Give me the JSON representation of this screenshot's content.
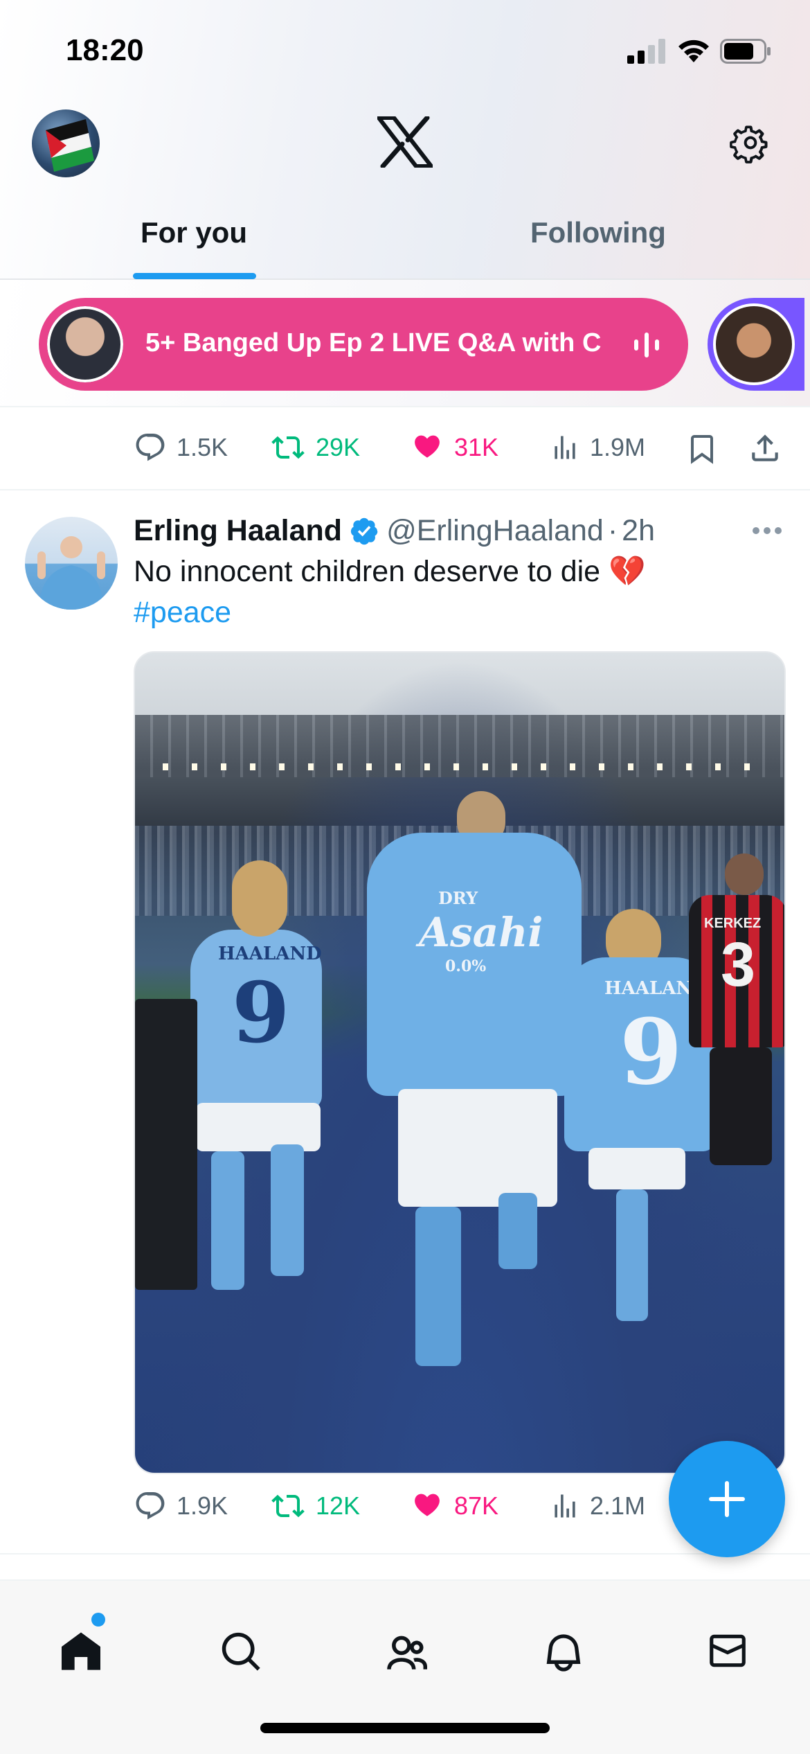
{
  "status_bar": {
    "time": "18:20"
  },
  "header": {
    "tabs": [
      {
        "label": "For you",
        "active": true
      },
      {
        "label": "Following",
        "active": false
      }
    ]
  },
  "spaces": {
    "pill_text": "5+ Banged Up Ep 2 LIVE Q&A with C",
    "pill_color": "#e8428b",
    "next_color": "#7856ff"
  },
  "previous_post_actions": {
    "replies": "1.5K",
    "reposts": "29K",
    "likes": "31K",
    "views": "1.9M"
  },
  "post": {
    "name": "Erling Haaland",
    "handle": "@ErlingHaaland",
    "separator": "·",
    "time": "2h",
    "text": "No innocent children deserve to die 💔",
    "hashtag": "#peace",
    "media_jersey_text": [
      "HAALAND",
      "9",
      "DRY",
      "Asahi",
      "0.0%",
      "KERKEZ",
      "3"
    ],
    "actions": {
      "replies": "1.9K",
      "reposts": "12K",
      "likes": "87K",
      "views": "2.1M"
    }
  },
  "colors": {
    "accent": "#1d9bf0",
    "repost": "#00ba7c",
    "like": "#f91880",
    "muted": "#536471"
  },
  "bottom_nav": [
    "home-icon",
    "search-icon",
    "communities-icon",
    "notifications-icon",
    "messages-icon"
  ]
}
